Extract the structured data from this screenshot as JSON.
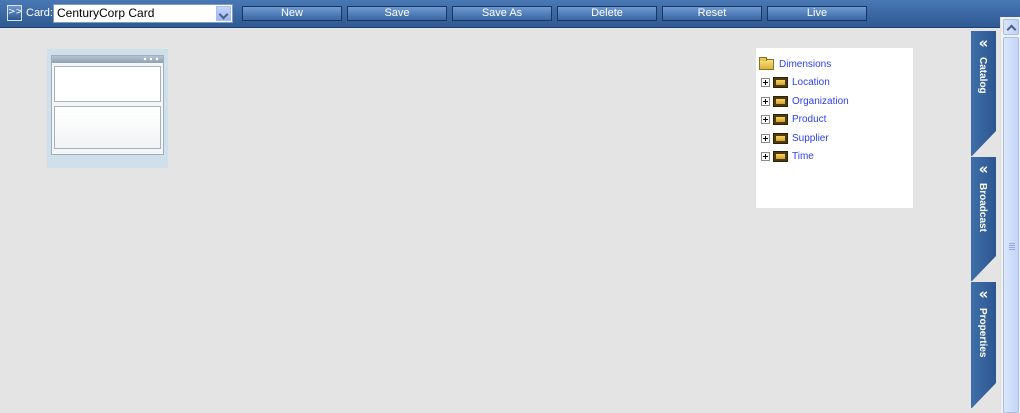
{
  "toolbar": {
    "expand_symbol": ">>",
    "card_label": "Card:",
    "card_value": "CenturyCorp Card",
    "buttons": [
      "New",
      "Save",
      "Save As",
      "Delete",
      "Reset",
      "Live"
    ]
  },
  "tree": {
    "root": "Dimensions",
    "items": [
      "Location",
      "Organization",
      "Product",
      "Supplier",
      "Time"
    ]
  },
  "side_tabs": [
    {
      "chevron": "«",
      "label": "Catalog"
    },
    {
      "chevron": "«",
      "label": "Broadcast"
    },
    {
      "chevron": "«",
      "label": "Properties"
    }
  ],
  "icons": {
    "expand": "expand-icon",
    "dropdown": "chevron-down-icon",
    "tree_root": "folder-open-icon",
    "tree_item": "dimension-icon",
    "tree_expander": "plus-box-icon"
  },
  "colors": {
    "toolbar": "#3b68a4",
    "canvas": "#e4e4e4",
    "link": "#2d3ff0",
    "tab": "#3a69a4"
  }
}
